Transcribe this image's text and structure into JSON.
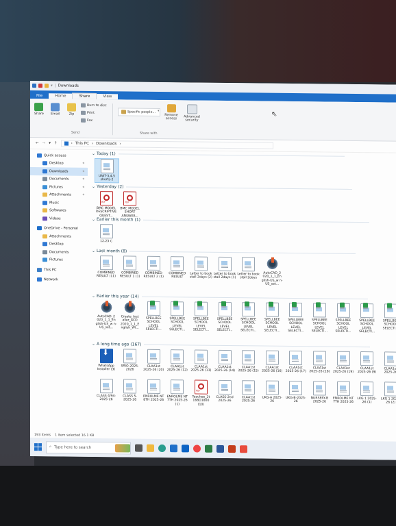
{
  "window": {
    "title": "Downloads"
  },
  "ribbon": {
    "tabs": [
      "File",
      "Home",
      "Share",
      "View"
    ],
    "buttons": {
      "share": "Share",
      "email": "Email",
      "zip": "Zip",
      "burn": "Burn to disc",
      "print": "Print",
      "fax": "Fax",
      "specific_people": "Specific people...",
      "remove_access": "Remove access",
      "advanced_security": "Advanced security"
    },
    "groups": {
      "send": "Send",
      "share_with": "Share with"
    }
  },
  "address": {
    "path": [
      "This PC",
      "Downloads"
    ]
  },
  "nav": {
    "items": [
      {
        "label": "Quick access",
        "icon": "star-icon",
        "indent": 0,
        "color": "#2f78d3",
        "pinned": false,
        "selected": false
      },
      {
        "label": "Desktop",
        "icon": "desktop-icon",
        "indent": 1,
        "color": "#2f78d3",
        "pinned": true,
        "selected": false
      },
      {
        "label": "Downloads",
        "icon": "download-icon",
        "indent": 1,
        "color": "#2f78d3",
        "pinned": true,
        "selected": true
      },
      {
        "label": "Documents",
        "icon": "documents-icon",
        "indent": 1,
        "color": "#7a8a9a",
        "pinned": true,
        "selected": false
      },
      {
        "label": "Pictures",
        "icon": "pictures-icon",
        "indent": 1,
        "color": "#3b8fd6",
        "pinned": true,
        "selected": false
      },
      {
        "label": "Attachments",
        "icon": "folder-icon",
        "indent": 1,
        "color": "#e9b84a",
        "pinned": true,
        "selected": false
      },
      {
        "label": "Music",
        "icon": "music-icon",
        "indent": 1,
        "color": "#2f78d3",
        "pinned": false,
        "selected": false
      },
      {
        "label": "Softwares",
        "icon": "folder-icon",
        "indent": 1,
        "color": "#e9b84a",
        "pinned": false,
        "selected": false
      },
      {
        "label": "Videos",
        "icon": "videos-icon",
        "indent": 1,
        "color": "#6b4fb8",
        "pinned": false,
        "selected": false
      },
      {
        "label": "OneDrive - Personal",
        "icon": "onedrive-icon",
        "indent": 0,
        "color": "#1f6fc9",
        "pinned": false,
        "selected": false
      },
      {
        "label": "Attachments",
        "icon": "folder-icon",
        "indent": 1,
        "color": "#e9b84a",
        "pinned": false,
        "selected": false
      },
      {
        "label": "Desktop",
        "icon": "desktop-icon",
        "indent": 1,
        "color": "#2f78d3",
        "pinned": false,
        "selected": false
      },
      {
        "label": "Documents",
        "icon": "documents-icon",
        "indent": 1,
        "color": "#7a8a9a",
        "pinned": false,
        "selected": false
      },
      {
        "label": "Pictures",
        "icon": "pictures-icon",
        "indent": 1,
        "color": "#3b8fd6",
        "pinned": false,
        "selected": false
      },
      {
        "label": "This PC",
        "icon": "pc-icon",
        "indent": 0,
        "color": "#3b7fc8",
        "pinned": false,
        "selected": false
      },
      {
        "label": "Network",
        "icon": "network-icon",
        "indent": 0,
        "color": "#2f78d3",
        "pinned": false,
        "selected": false
      }
    ]
  },
  "groups": [
    {
      "header": "Today (1)",
      "files": [
        {
          "name": "UNIT-3,4,5 shorts-2",
          "icon": "gen",
          "selected": true
        }
      ]
    },
    {
      "header": "Yesterday (2)",
      "files": [
        {
          "name": "BMC MODEL DESCRIPTIVE QUEST...",
          "icon": "pdf"
        },
        {
          "name": "BMC MODEL SHORT ANSWER...",
          "icon": "pdf"
        }
      ]
    },
    {
      "header": "Earlier this month (1)",
      "files": [
        {
          "name": "12.23 C",
          "icon": "gen"
        }
      ]
    },
    {
      "header": "Last month (8)",
      "files": [
        {
          "name": "COMBINED RESULT (11)",
          "icon": "gen"
        },
        {
          "name": "COMBINED RESULT 1 (1)",
          "icon": "gen"
        },
        {
          "name": "COMBINED RESULT 2 (1)",
          "icon": "gen"
        },
        {
          "name": "COMBINED RESULT",
          "icon": "gen"
        },
        {
          "name": "Letter to book stall 2days (2)",
          "icon": "gen"
        },
        {
          "name": "Letter to book stall 2days (1)",
          "icon": "gen"
        },
        {
          "name": "Letter to book stall 2days",
          "icon": "gen"
        },
        {
          "name": "AutoCAD_2 020_1_1_En glish-US_w n-US_set...",
          "icon": "disc"
        }
      ]
    },
    {
      "header": "Earlier this year (14)",
      "files": [
        {
          "name": "AutoCAD_2 020_1_1_En glish-US_w n-US_set...",
          "icon": "disc"
        },
        {
          "name": "Create_Inst aller_ACD 2020_1_1_E nglish_WI...",
          "icon": "disc"
        },
        {
          "name": "SPELLBEE SCHOOL LEVEL SELECTI...",
          "icon": "sx"
        },
        {
          "name": "SPELLBEE SCHOOL LEVEL SELECTI...",
          "icon": "sx"
        },
        {
          "name": "SPELLBEE SCHOOL LEVEL SELECTI...",
          "icon": "sx"
        },
        {
          "name": "SPELLBEE SCHOOL LEVEL SELECTI...",
          "icon": "sx"
        },
        {
          "name": "SPELLBEE SCHOOL LEVEL SELECTI...",
          "icon": "sx"
        },
        {
          "name": "SPELLBEE SCHOOL LEVEL SELECTI...",
          "icon": "sx"
        },
        {
          "name": "SPELLBEE SCHOOL LEVEL SELECTI...",
          "icon": "sx"
        },
        {
          "name": "SPELLBEE SCHOOL LEVEL SELECTI...",
          "icon": "sx"
        },
        {
          "name": "SPELLBEE SCHOOL LEVEL SELECTI...",
          "icon": "sx"
        },
        {
          "name": "SPELLBEE SCHOOL LEVEL SELECTI...",
          "icon": "sx"
        },
        {
          "name": "SPELLBEE SCHOOL SELECTI...",
          "icon": "sx"
        }
      ]
    },
    {
      "header": "A long time ago (167)",
      "files": [
        {
          "name": "WhatsApp Installer (3)",
          "icon": "dl"
        },
        {
          "name": "SRIO-2025-2026",
          "icon": "gen"
        },
        {
          "name": "CLAA1st 2025-26 (20)",
          "icon": "gen"
        },
        {
          "name": "CLAA1st 2025-26 (12)",
          "icon": "gen"
        },
        {
          "name": "CLAA1st 2025-26 (13)",
          "icon": "gen"
        },
        {
          "name": "CLAA1st 2025-26 (14)",
          "icon": "gen"
        },
        {
          "name": "CLAA1st 2025-26 (15)",
          "icon": "gen"
        },
        {
          "name": "CLAA1st 2025-26 (16)",
          "icon": "gen"
        },
        {
          "name": "CLAA1st 2025-26 (17)",
          "icon": "gen"
        },
        {
          "name": "CLAA1st 2025-26 (18)",
          "icon": "gen"
        },
        {
          "name": "CLAA1st 2025-26 (19)",
          "icon": "gen"
        },
        {
          "name": "CLAA1st 2025-26 (9)",
          "icon": "gen"
        },
        {
          "name": "CLAA1st 2025-26",
          "icon": "gen"
        },
        {
          "name": "CLASS 4/94-2025-26",
          "icon": "gen"
        },
        {
          "name": "CLASS 5-2025-26",
          "icon": "gen"
        },
        {
          "name": "ENROLME NT 8TH 2025-26",
          "icon": "gen"
        },
        {
          "name": "ENROLME NT 7TH 2025-26 (1)",
          "icon": "gen"
        },
        {
          "name": "Teachee_2t 168D1800 (10)",
          "icon": "pdf"
        },
        {
          "name": "CLASS-2nd 2025-26",
          "icon": "gen"
        },
        {
          "name": "CLAA1st 2025-26",
          "icon": "gen"
        },
        {
          "name": "UKG-A 2025-26",
          "icon": "gen"
        },
        {
          "name": "UKG-B-2025-26",
          "icon": "gen"
        },
        {
          "name": "NURSERY-B 2025-26",
          "icon": "gen"
        },
        {
          "name": "ENROLME NT 7TH 2025-26",
          "icon": "gen"
        },
        {
          "name": "LKG 1 2025-26 (1)",
          "icon": "gen"
        },
        {
          "name": "LKG 1 2025-26 (2)",
          "icon": "gen"
        }
      ]
    }
  ],
  "status": {
    "count": "193 items",
    "selected": "1 item selected 16.1 KB"
  },
  "taskbar": {
    "search_placeholder": "Type here to search"
  },
  "colors": {
    "accent": "#1f6fc9",
    "selection": "#cce4f7"
  }
}
